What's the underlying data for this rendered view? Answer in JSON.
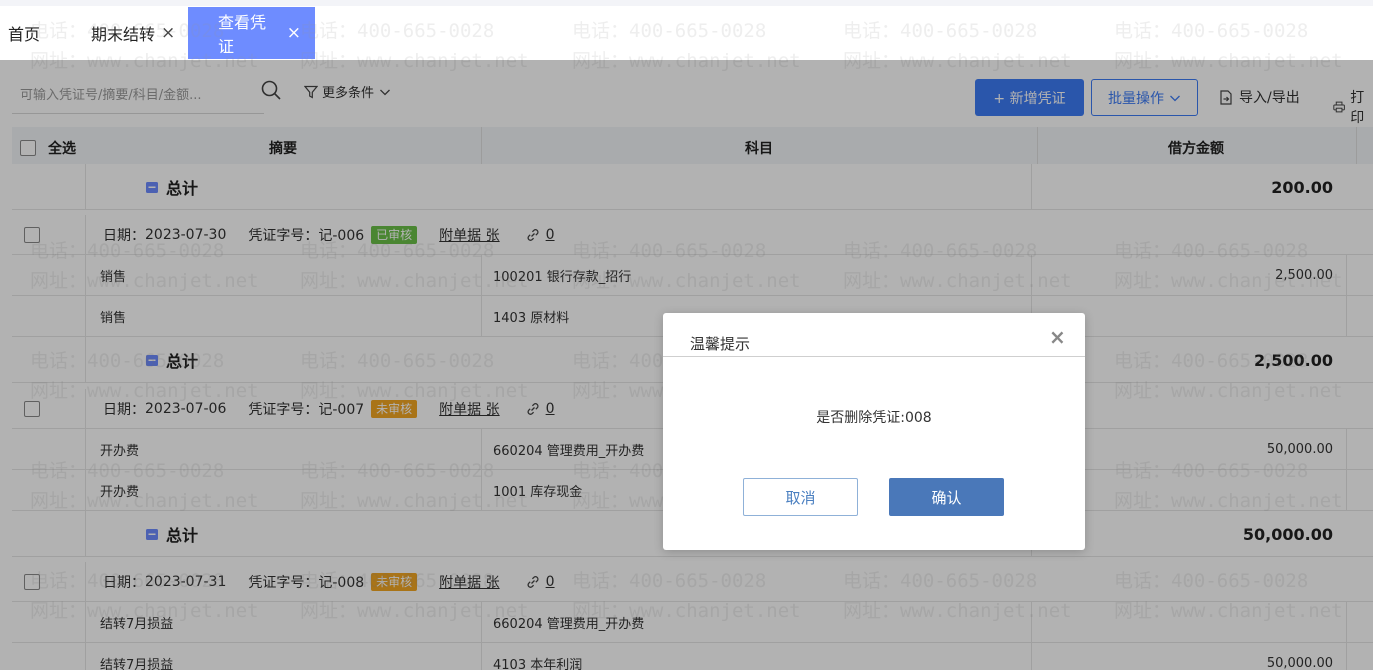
{
  "tabs": [
    {
      "label": "首页"
    },
    {
      "label": "期末结转",
      "close": "×"
    },
    {
      "label": "查看凭证",
      "close": "×"
    }
  ],
  "toolbar": {
    "search_placeholder": "可输入凭证号/摘要/科目/金额...",
    "more_conditions": "更多条件",
    "add_voucher": "+ 新增凭证",
    "batch_ops": "批量操作",
    "import_export": "导入/导出",
    "print": "打印"
  },
  "table": {
    "headers": {
      "select_all": "全选",
      "summary": "摘要",
      "account": "科目",
      "debit": "借方金额"
    },
    "total_label": "总计",
    "date_prefix": "日期：",
    "voucher_prefix": "凭证字号：",
    "attach_label": "附单据 张",
    "top_total": "200.00",
    "vouchers": [
      {
        "date": "2023-07-30",
        "number": "记-006",
        "status": "已审核",
        "attach_count": "0",
        "lines": [
          {
            "summary": "销售",
            "account": "100201 银行存款_招行",
            "debit": "2,500.00"
          },
          {
            "summary": "销售",
            "account": "1403 原材料",
            "debit": ""
          }
        ],
        "total": "2,500.00"
      },
      {
        "date": "2023-07-06",
        "number": "记-007",
        "status": "未审核",
        "attach_count": "0",
        "lines": [
          {
            "summary": "开办费",
            "account": "660204 管理费用_开办费",
            "debit": "50,000.00"
          },
          {
            "summary": "开办费",
            "account": "1001 库存现金",
            "debit": ""
          }
        ],
        "total": "50,000.00"
      },
      {
        "date": "2023-07-31",
        "number": "记-008",
        "status": "未审核",
        "attach_count": "0",
        "lines": [
          {
            "summary": "结转7月损益",
            "account": "660204 管理费用_开办费",
            "debit": ""
          },
          {
            "summary": "结转7月损益",
            "account": "4103 本年利润",
            "debit": "50,000.00"
          }
        ]
      }
    ]
  },
  "watermark": {
    "phone": "电话：400-665-0028",
    "site": "网址：www.chanjet.net"
  },
  "dialog": {
    "title": "温馨提示",
    "close": "×",
    "message": "是否删除凭证:008",
    "cancel": "取消",
    "confirm": "确认"
  },
  "colors": {
    "active_tab": "#6e8cff",
    "primary": "#3d7bf5",
    "audited": "#6ac048",
    "unaudited": "#f2a623",
    "confirm_button": "#4a78b9"
  }
}
